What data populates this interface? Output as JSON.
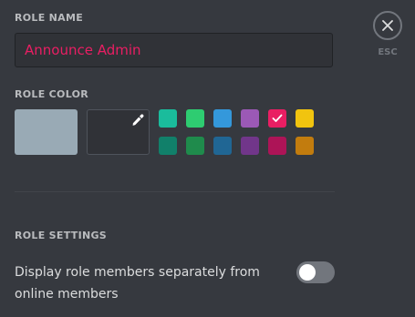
{
  "role_name": {
    "label": "ROLE NAME",
    "value": "Announce Admin"
  },
  "close": {
    "icon": "close-icon",
    "esc_label": "ESC"
  },
  "role_color": {
    "label": "ROLE COLOR",
    "default_color": "#99aab5",
    "custom_icon": "eyedropper-icon",
    "selected_color": "#e91e63",
    "swatches_row1": [
      "#1abc9c",
      "#2ecc71",
      "#3498db",
      "#9b59b6",
      "#e91e63",
      "#f1c40f"
    ],
    "swatches_row2": [
      "#11806a",
      "#1f8b4c",
      "#206694",
      "#71368a",
      "#ad1457",
      "#c27c0e"
    ]
  },
  "role_settings": {
    "label": "ROLE SETTINGS",
    "display_separately": {
      "text": "Display role members separately from online members",
      "enabled": false
    }
  }
}
